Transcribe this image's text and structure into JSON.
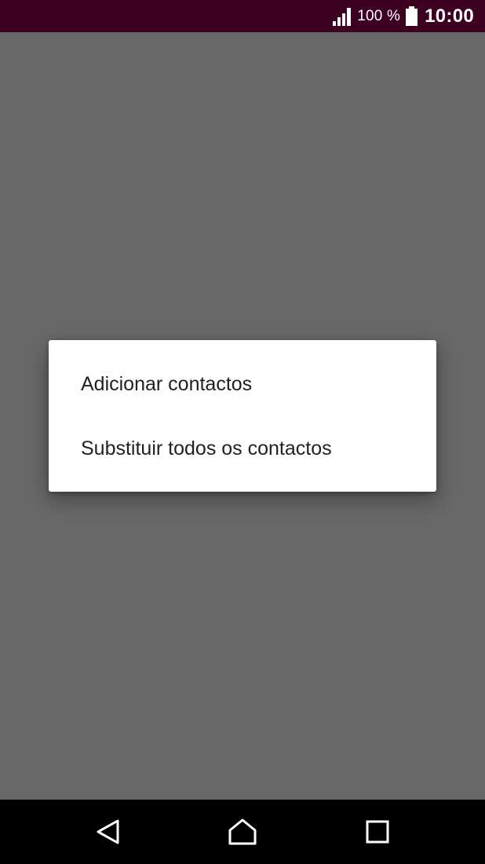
{
  "status_bar": {
    "battery_percent": "100 %",
    "time": "10:00",
    "background": "#3d0020"
  },
  "dialog": {
    "items": [
      {
        "label": "Adicionar contactos"
      },
      {
        "label": "Substituir todos os contactos"
      }
    ]
  },
  "nav_bar": {
    "buttons": [
      "back-icon",
      "home-icon",
      "recents-icon"
    ]
  }
}
